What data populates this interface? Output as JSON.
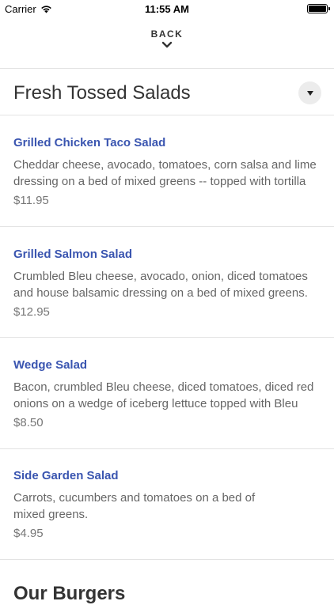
{
  "status_bar": {
    "carrier": "Carrier",
    "time": "11:55 AM"
  },
  "nav": {
    "back_label": "BACK"
  },
  "section": {
    "title": "Fresh Tossed Salads"
  },
  "items": [
    {
      "name": "Grilled Chicken Taco Salad",
      "description": "Cheddar cheese, avocado, tomatoes, corn salsa and lime dressing on a bed of mixed greens -- topped with tortilla",
      "price": "$11.95"
    },
    {
      "name": "Grilled Salmon Salad",
      "description": "Crumbled Bleu cheese, avocado, onion, diced tomatoes and house balsamic dressing on a bed of mixed greens.",
      "price": "$12.95"
    },
    {
      "name": "Wedge Salad",
      "description": "Bacon, crumbled Bleu cheese, diced tomatoes, diced red onions on a wedge of iceberg lettuce topped with Bleu",
      "price": "$8.50"
    },
    {
      "name": "Side Garden Salad",
      "description": "Carrots, cucumbers and tomatoes on a bed of mixed greens.",
      "price": "$4.95"
    }
  ],
  "next_section": {
    "title": "Our Burgers"
  }
}
